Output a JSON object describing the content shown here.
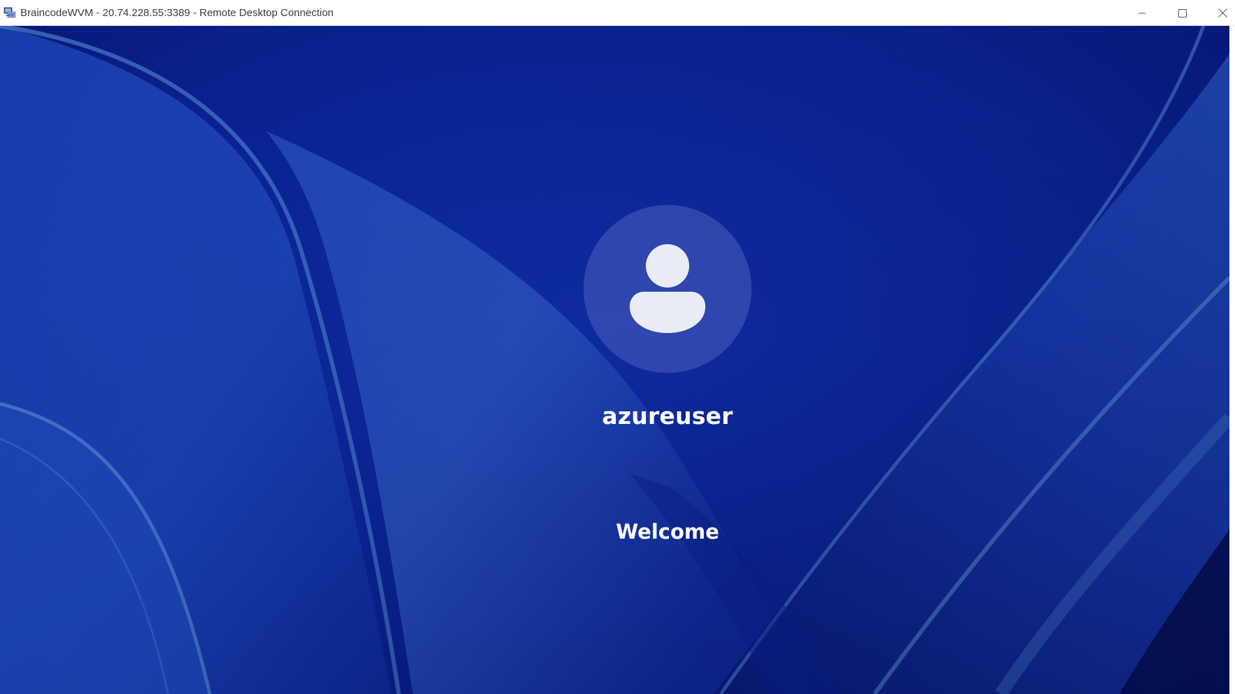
{
  "window": {
    "title": "BraincodeWVM - 20.74.228.55:3389 - Remote Desktop Connection",
    "app_icon": "remote-desktop-icon",
    "controls": {
      "minimize": "minimize-icon",
      "maximize": "maximize-icon",
      "close": "close-icon"
    }
  },
  "lock_screen": {
    "avatar_icon": "user-avatar-icon",
    "username": "azureuser",
    "status_text": "Welcome"
  },
  "colors": {
    "wallpaper_base": "#0a1f8e",
    "wallpaper_light": "#3a63c8",
    "text": "#ffffff"
  }
}
